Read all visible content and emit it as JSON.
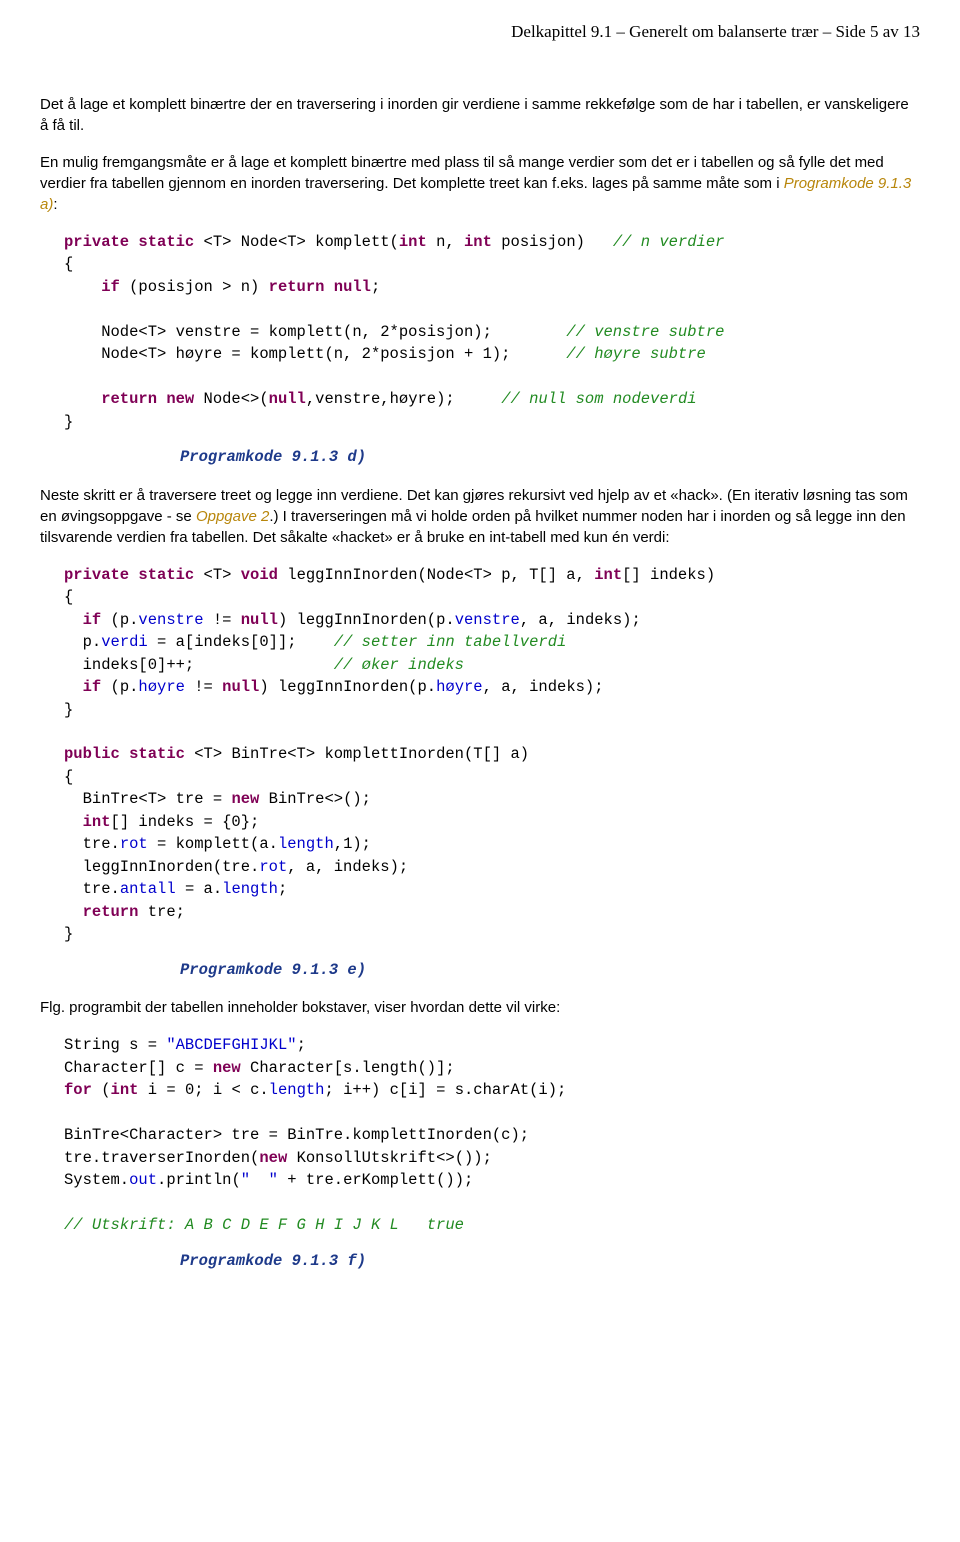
{
  "header": {
    "chapter": "Delkapittel 9.1",
    "sep1": "  –  ",
    "title": "Generelt om balanserte trær",
    "sep2": "  –  ",
    "page": "Side 5 av 13"
  },
  "p1": "Det å lage et komplett binærtre der en traversering i inorden gir verdiene i samme rekkefølge som de har i tabellen, er vanskeligere å få til.",
  "p2a": "En mulig fremgangsmåte er å lage et komplett binærtre med plass til så mange verdier som det er i tabellen og så fylle det med verdier fra tabellen gjennom en inorden traversering. Det komplette treet kan f.eks. lages på samme måte som i ",
  "p2link": "Programkode 9.1.3 a)",
  "p2b": ":",
  "code1": {
    "l1a": "private static ",
    "l1b": "<T> Node<T> komplett(",
    "l1c": "int ",
    "l1d": "n, ",
    "l1e": "int ",
    "l1f": "posisjon)   ",
    "l1g": "// n verdier",
    "l2": "{",
    "l3a": "    if ",
    "l3b": "(posisjon > n) ",
    "l3c": "return null",
    "l3d": ";",
    "l4": "",
    "l5a": "    Node<T> venstre = komplett(n, 2*posisjon);        ",
    "l5b": "// venstre subtre",
    "l6a": "    Node<T> høyre = komplett(n, 2*posisjon + 1);      ",
    "l6b": "// høyre subtre",
    "l7": "",
    "l8a": "    return new ",
    "l8b": "Node<>(",
    "l8c": "null",
    "l8d": ",venstre,høyre);     ",
    "l8e": "// null som nodeverdi",
    "l9": "}"
  },
  "cap1": "Programkode 9.1.3 d)",
  "p3a": "Neste skritt er å traversere treet og legge inn verdiene. Det kan gjøres rekursivt ved hjelp av et «hack». (En iterativ løsning tas som en øvingsoppgave - se ",
  "p3link": "Oppgave 2",
  "p3b": ".) I traverseringen må vi holde orden på hvilket nummer noden har i inorden og så legge inn den tilsvarende verdien fra tabellen. Det såkalte «hacket» er å bruke en int-tabell med kun én verdi:",
  "code2": {
    "l1a": "private static ",
    "l1b": "<T> ",
    "l1c": "void ",
    "l1d": "leggInnInorden(Node<T> p, T[] a, ",
    "l1e": "int",
    "l1f": "[] indeks)",
    "l2": "{",
    "l3a": "  if ",
    "l3b": "(p.",
    "l3c": "venstre ",
    "l3d": "!= ",
    "l3e": "null",
    "l3f": ") leggInnInorden(p.",
    "l3g": "venstre",
    "l3h": ", a, indeks);",
    "l4a": "  p.",
    "l4b": "verdi ",
    "l4c": "= a[indeks[0]];    ",
    "l4d": "// setter inn tabellverdi",
    "l5a": "  indeks[0]++;               ",
    "l5b": "// øker indeks",
    "l6a": "  if ",
    "l6b": "(p.",
    "l6c": "høyre ",
    "l6d": "!= ",
    "l6e": "null",
    "l6f": ") leggInnInorden(p.",
    "l6g": "høyre",
    "l6h": ", a, indeks);",
    "l7": "}",
    "l8": "",
    "l9a": "public static ",
    "l9b": "<T> BinTre<T> komplettInorden(T[] a)",
    "l10": "{",
    "l11a": "  BinTre<T> tre = ",
    "l11b": "new ",
    "l11c": "BinTre<>();",
    "l12a": "  int",
    "l12b": "[] indeks = {0};",
    "l13a": "  tre.",
    "l13b": "rot ",
    "l13c": "= komplett(a.",
    "l13d": "length",
    "l13e": ",1);",
    "l14a": "  leggInnInorden(tre.",
    "l14b": "rot",
    "l14c": ", a, indeks);",
    "l15a": "  tre.",
    "l15b": "antall ",
    "l15c": "= a.",
    "l15d": "length",
    "l15e": ";",
    "l16a": "  return ",
    "l16b": "tre;",
    "l17": "}"
  },
  "cap2": "Programkode 9.1.3 e)",
  "p4": "Flg. programbit der tabellen inneholder bokstaver, viser hvordan dette vil virke:",
  "code3": {
    "l1a": "String s = ",
    "l1b": "\"ABCDEFGHIJKL\"",
    "l1c": ";",
    "l2a": "Character[] c = ",
    "l2b": "new ",
    "l2c": "Character[s.length()];",
    "l3a": "for ",
    "l3b": "(",
    "l3c": "int ",
    "l3d": "i = 0; i < c.",
    "l3e": "length",
    "l3f": "; i++) c[i] = s.charAt(i);",
    "l4": "",
    "l5": "BinTre<Character> tre = BinTre.komplettInorden(c);",
    "l6a": "tre.traverserInorden(",
    "l6b": "new ",
    "l6c": "KonsollUtskrift<>());",
    "l7a": "System.",
    "l7b": "out",
    "l7c": ".println(",
    "l7d": "\"  \" ",
    "l7e": "+ tre.erKomplett());",
    "l8": "",
    "l9": "// Utskrift: A B C D E F G H I J K L   true"
  },
  "cap3": "Programkode 9.1.3 f)"
}
